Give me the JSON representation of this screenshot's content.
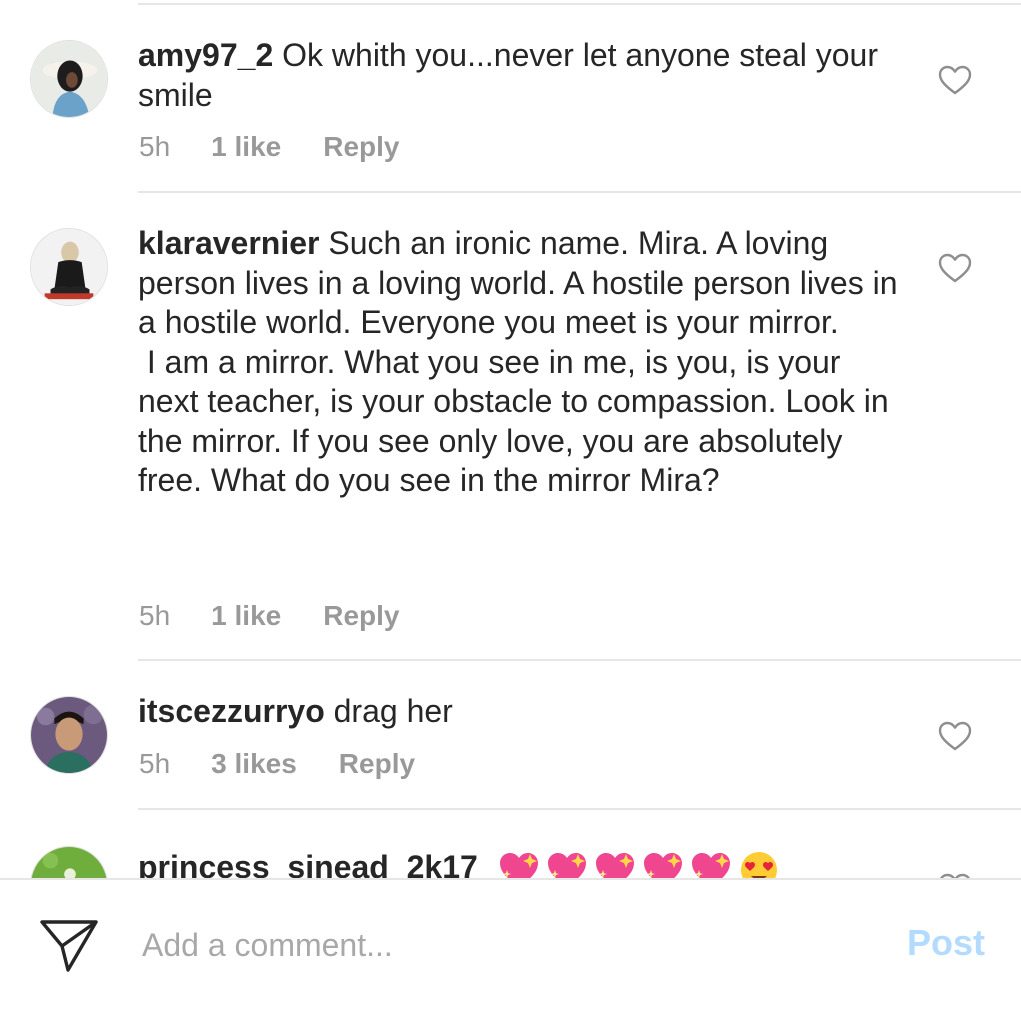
{
  "comments": [
    {
      "username": "amy97_2",
      "text": "Ok whith you...never let anyone steal your smile",
      "time": "5h",
      "likes": "1 like",
      "reply_label": "Reply"
    },
    {
      "username": "klaravernier",
      "text": "Such an ironic name. Mira. A loving person lives in a loving world. A hostile person lives in a hostile world. Everyone you meet is your mirror.\n I am a mirror. What you see in me, is you, is your next teacher, is your obstacle to compassion. Look in the mirror. If you see only love, you are absolutely free. What do you see in the mirror Mira?",
      "time": "5h",
      "likes": "1 like",
      "reply_label": "Reply"
    },
    {
      "username": "itscezzurryo",
      "text": "drag her",
      "time": "5h",
      "likes": "3 likes",
      "reply_label": "Reply"
    },
    {
      "username": "princess_sinead_2k17",
      "emojis": [
        "sparkling-heart-icon",
        "sparkling-heart-icon",
        "sparkling-heart-icon",
        "sparkling-heart-icon",
        "sparkling-heart-icon",
        "heart-eyes-face-icon"
      ]
    }
  ],
  "composer": {
    "placeholder": "Add a comment...",
    "post_label": "Post",
    "share_icon": "paper-plane-icon"
  },
  "colors": {
    "text": "#262626",
    "meta": "#999999",
    "divider": "#e6e6e6",
    "post_disabled": "#b3dbff",
    "emoji_heart": "#f0458f"
  }
}
